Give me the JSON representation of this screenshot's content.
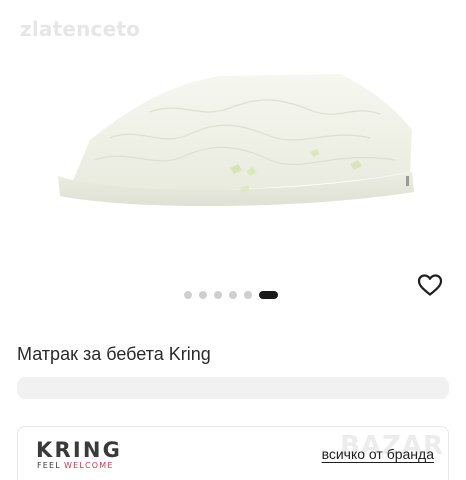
{
  "gallery": {
    "watermark": "zlatenceto",
    "image_alt": "Матрак за бебета Kring",
    "pagination": {
      "total": 6,
      "active_index": 5
    },
    "favorite_icon": "heart-outline-icon"
  },
  "product": {
    "title": "Матрак за бебета Kring"
  },
  "brand": {
    "name": "KRING",
    "slogan_part1": "FEEL",
    "slogan_part2": "WELCOME",
    "link_label": "всичко от бранда",
    "site_mark": "BAZAR"
  },
  "colors": {
    "brand_accent": "#d6334f",
    "dot_active": "#1a1a1a",
    "dot_inactive": "#cfcfcf"
  }
}
